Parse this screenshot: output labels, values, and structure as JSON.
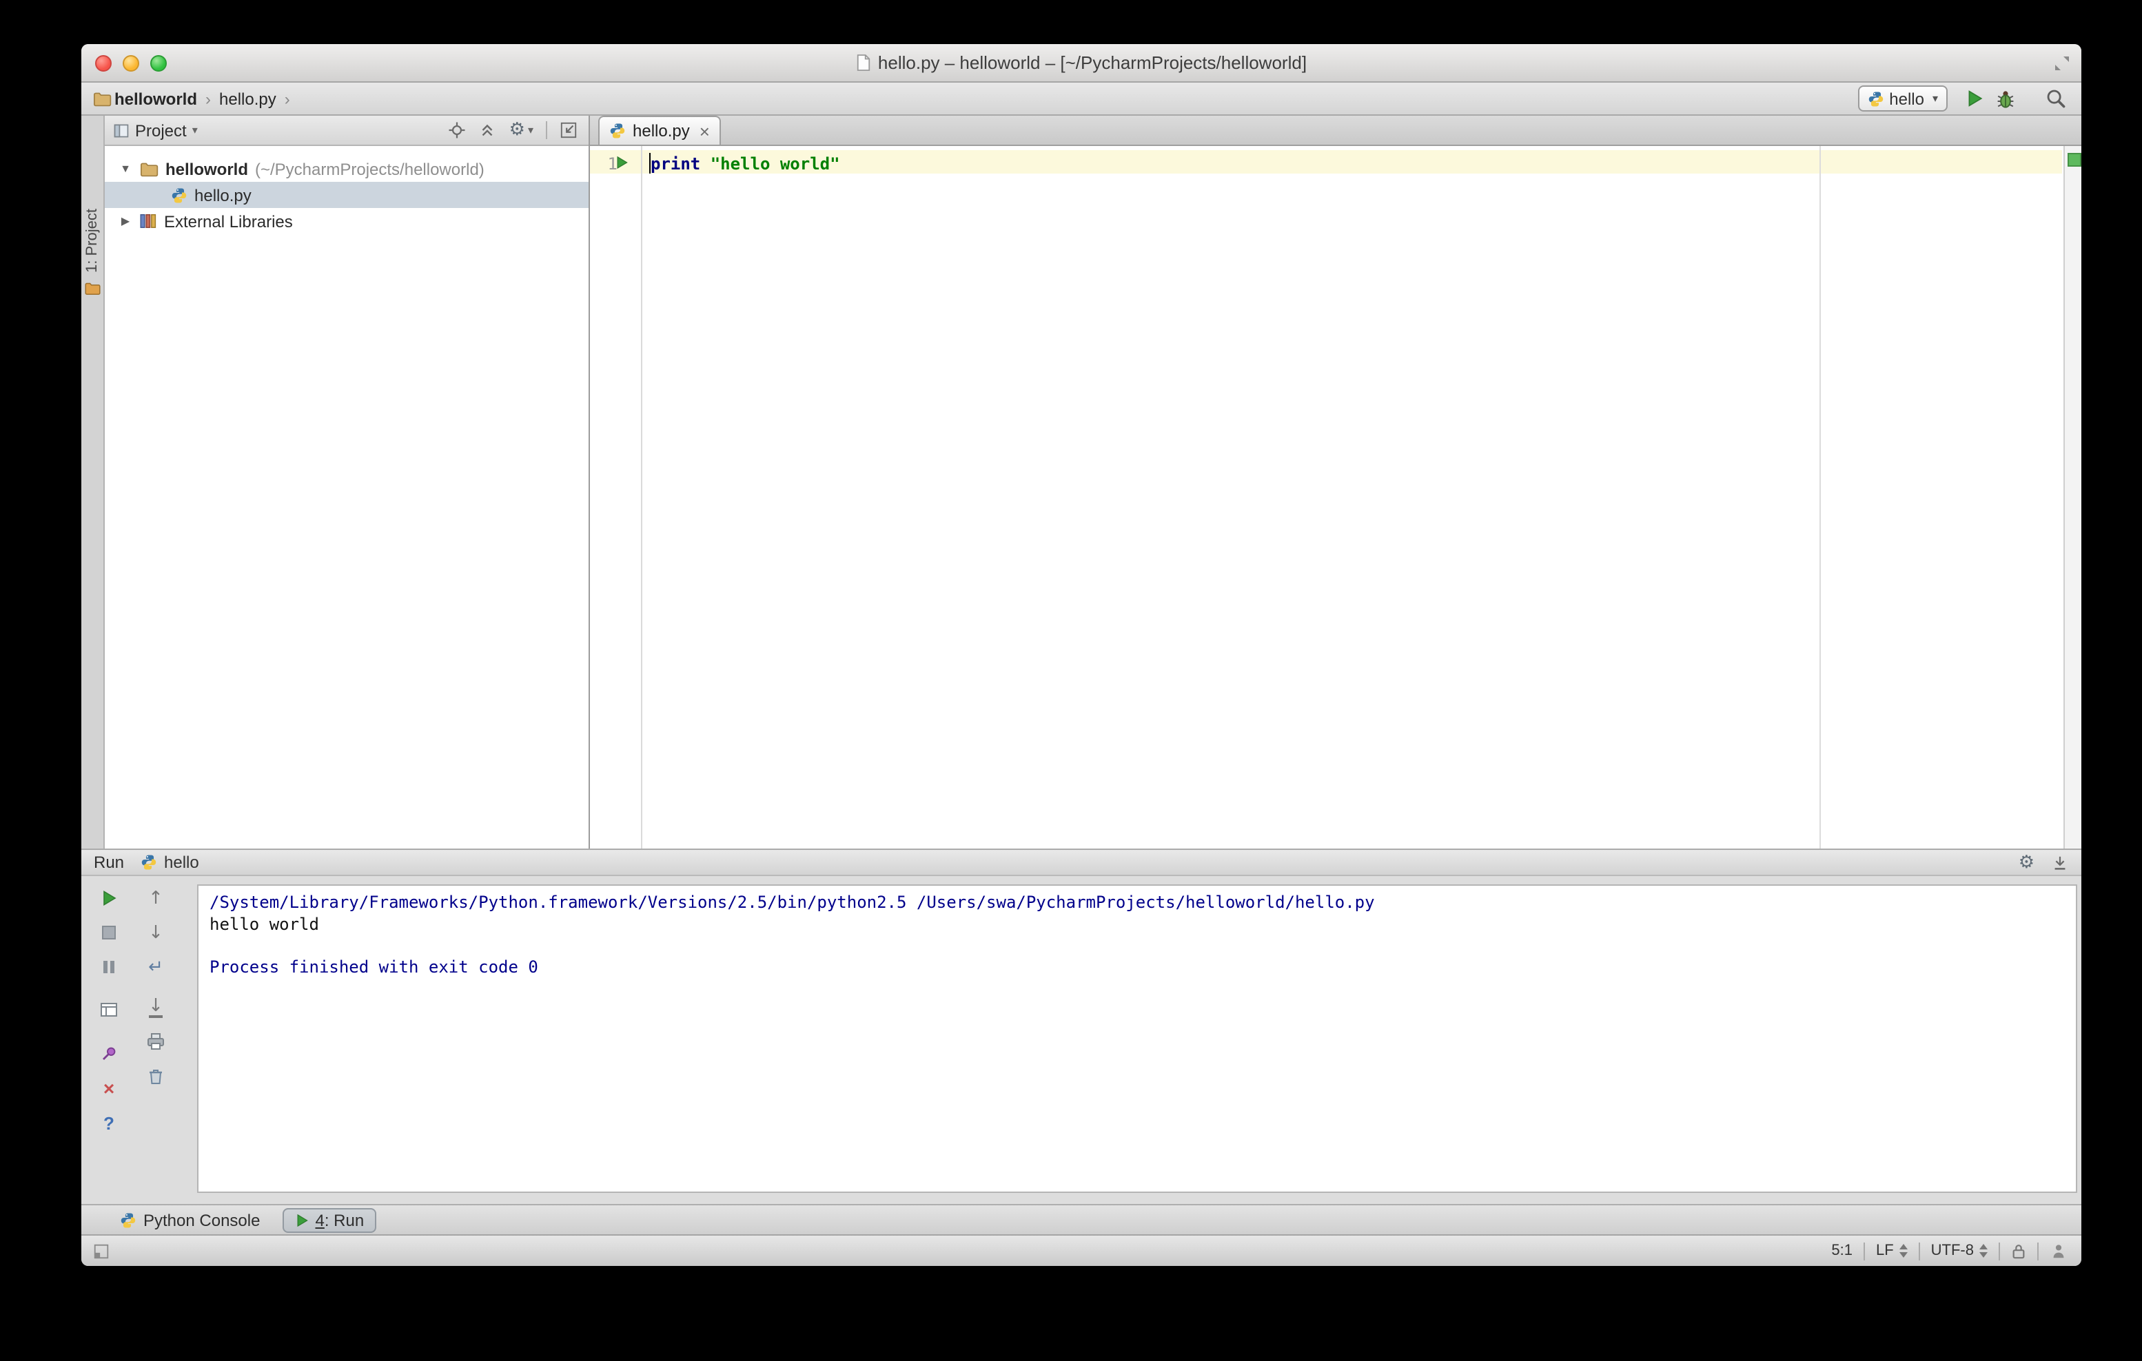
{
  "window": {
    "title": "hello.py – helloworld – [~/PycharmProjects/helloworld]"
  },
  "navbar": {
    "crumbs": [
      "helloworld",
      "hello.py"
    ],
    "run_config": "hello"
  },
  "tool_stripe": {
    "project_button": "1: Project"
  },
  "project_panel": {
    "header": "Project",
    "tree": {
      "root_name": "helloworld",
      "root_path": "(~/PycharmProjects/helloworld)",
      "file": "hello.py",
      "libs": "External Libraries"
    }
  },
  "editor": {
    "tab": "hello.py",
    "line_number": "1",
    "code": {
      "keyword": "print",
      "string": " \"hello world\""
    }
  },
  "run_panel": {
    "title": "Run",
    "config": "hello",
    "console": {
      "cmd": "/System/Library/Frameworks/Python.framework/Versions/2.5/bin/python2.5 /Users/swa/PycharmProjects/helloworld/hello.py",
      "stdout": "hello world",
      "exit": "Process finished with exit code 0"
    }
  },
  "bottom_bar": {
    "python_console": "Python Console",
    "run_tab_number": "4",
    "run_tab_suffix": ": Run"
  },
  "status_bar": {
    "caret_position": "5:1",
    "line_separator": "LF",
    "encoding": "UTF-8"
  },
  "icons": {
    "chevron": "›",
    "dropdown": "▾",
    "tree_expanded": "▼",
    "tree_collapsed": "▶",
    "close": "×",
    "gear": "⚙",
    "arrow_up": "↑",
    "arrow_down": "↓",
    "soft_wrap": "↵",
    "help": "?"
  },
  "colors": {
    "keyword": "#000080",
    "string": "#008000",
    "console_system": "#00008b",
    "run_green": "#3b9e3b",
    "caret_row": "#fcf9dc",
    "selection": "#ccd5de",
    "stripe_ok": "#5eb95e"
  }
}
